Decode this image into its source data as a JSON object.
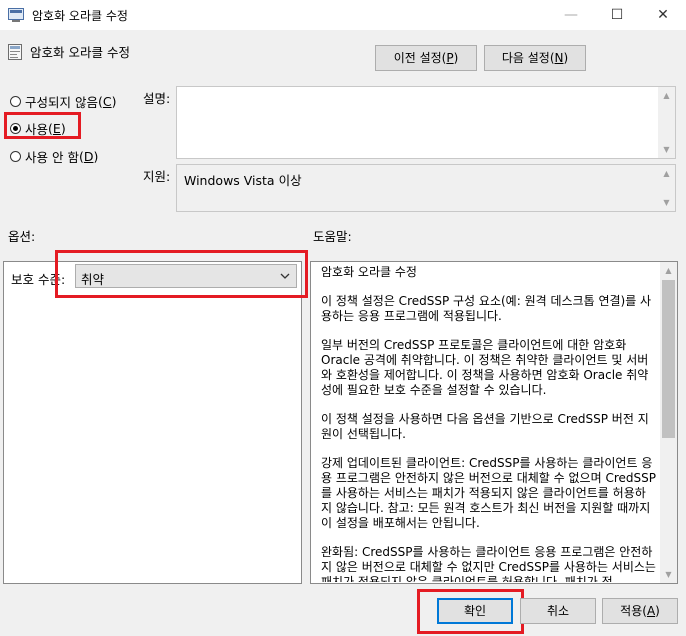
{
  "window": {
    "title": "암호화 오라클 수정",
    "controls": {
      "minimize": "—",
      "maximize": "☐",
      "close": "✕"
    }
  },
  "header": {
    "policy_title": "암호화 오라클 수정",
    "prev_setting": {
      "label": "이전 설정",
      "key": "P"
    },
    "next_setting": {
      "label": "다음 설정",
      "key": "N"
    }
  },
  "state": {
    "options": [
      {
        "label": "구성되지 않음",
        "key": "C",
        "selected": false
      },
      {
        "label": "사용",
        "key": "E",
        "selected": true
      },
      {
        "label": "사용 안 함",
        "key": "D",
        "selected": false
      }
    ]
  },
  "comment": {
    "label": "설명:",
    "value": ""
  },
  "supported": {
    "label": "지원:",
    "value": "Windows Vista 이상"
  },
  "options_panel": {
    "label": "옵션:",
    "protection_level_label": "보호 수준:",
    "protection_level_value": "취약"
  },
  "help_panel": {
    "label": "도움말:",
    "paragraphs": [
      "암호화 오라클 수정",
      "이 정책 설정은 CredSSP 구성 요소(예: 원격 데스크톱 연결)를 사용하는 응용 프로그램에 적용됩니다.",
      "일부 버전의 CredSSP 프로토콜은 클라이언트에 대한 암호화 Oracle 공격에 취약합니다.  이 정책은 취약한 클라이언트 및 서버와 호환성을 제어합니다.  이 정책을 사용하면 암호화 Oracle 취약성에 필요한 보호 수준을 설정할 수 있습니다.",
      "이 정책 설정을 사용하면 다음 옵션을 기반으로 CredSSP 버전 지원이 선택됩니다.",
      "강제 업데이트된 클라이언트: CredSSP를 사용하는 클라이언트 응용 프로그램은 안전하지 않은 버전으로 대체할 수 없으며 CredSSP를 사용하는 서비스는 패치가 적용되지 않은 클라이언트를 허용하지 않습니다. 참고: 모든 원격 호스트가 최신 버전을 지원할 때까지 이 설정을 배포해서는 안됩니다.",
      "완화됨: CredSSP를 사용하는 클라이언트 응용 프로그램은 안전하지 않은 버전으로 대체할 수 없지만 CredSSP를 사용하는 서비스는 패치가 적용되지 않은 클라이언트를 허용합니다. 패치가 적"
    ]
  },
  "footer": {
    "ok": "확인",
    "cancel": "취소",
    "apply": {
      "label": "적용",
      "key": "A"
    }
  },
  "colors": {
    "highlight": "#e41b23",
    "background": "#f0f0f0",
    "focus_border": "#0078d7"
  }
}
